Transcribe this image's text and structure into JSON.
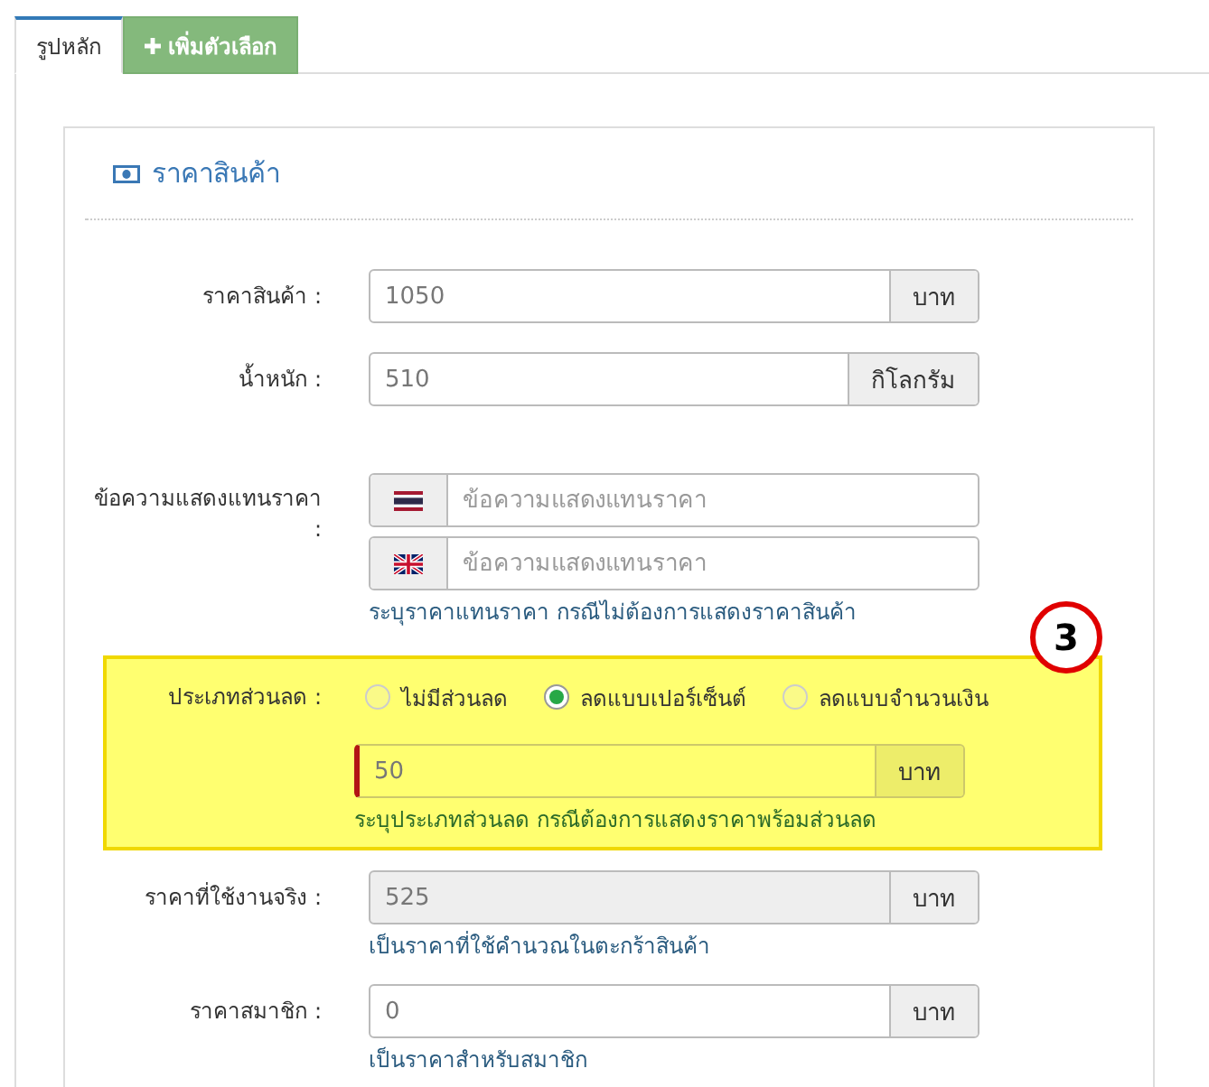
{
  "tabs": [
    {
      "label": "รูปหลัก",
      "kind": "tab",
      "selected": true
    },
    {
      "label": "เพิ่มตัวเลือก",
      "kind": "add",
      "selected": false
    }
  ],
  "card": {
    "title": "ราคาสินค้า",
    "rows": [
      {
        "kind": "input",
        "label": "ราคาสินค้า :",
        "value": "1050",
        "unit": "บาท",
        "disabled": false
      },
      {
        "kind": "input",
        "label": "น้ำหนัก :",
        "value": "510",
        "unit": "กิโลกรัม",
        "disabled": false
      },
      {
        "kind": "lang",
        "label": "ข้อความแสดงแทนราคา :",
        "inputs": [
          {
            "kind": "th",
            "placeholder": "ข้อความแสดงแทนราคา"
          },
          {
            "kind": "gb",
            "placeholder": "ข้อความแสดงแทนราคา"
          }
        ],
        "help": "ระบุราคาแทนราคา กรณีไม่ต้องการแสดงราคาสินค้า"
      },
      {
        "kind": "discount",
        "label": "ประเภทส่วนลด :",
        "options": [
          {
            "label": "ไม่มีส่วนลด",
            "selected": false
          },
          {
            "label": "ลดแบบเปอร์เซ็นต์",
            "selected": true
          },
          {
            "label": "ลดแบบจำนวนเงิน",
            "selected": false
          }
        ],
        "value": "50",
        "unit": "บาท",
        "invalid": true,
        "help": "ระบุประเภทส่วนลด กรณีต้องการแสดงราคาพร้อมส่วนลด",
        "callout": "3"
      },
      {
        "kind": "input",
        "label": "ราคาที่ใช้งานจริง :",
        "value": "525",
        "unit": "บาท",
        "disabled": true,
        "help": "เป็นราคาที่ใช้คำนวณในตะกร้าสินค้า"
      },
      {
        "kind": "input",
        "label": "ราคาสมาชิก :",
        "value": "0",
        "unit": "บาท",
        "disabled": false,
        "help": "เป็นราคาสำหรับสมาชิก"
      }
    ]
  }
}
